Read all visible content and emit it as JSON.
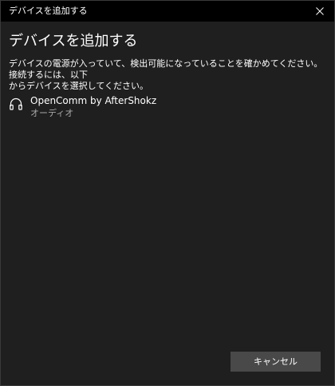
{
  "window": {
    "title": "デバイスを追加する"
  },
  "main": {
    "heading": "デバイスを追加する",
    "instructions_line1": "デバイスの電源が入っていて、検出可能になっていることを確かめてください。接続するには、以下",
    "instructions_line2": "からデバイスを選択してください。"
  },
  "devices": [
    {
      "name": "OpenComm by AfterShokz",
      "type": "オーディオ",
      "icon": "headphones-icon"
    }
  ],
  "footer": {
    "cancel_label": "キャンセル"
  },
  "colors": {
    "background": "#1f1f1f",
    "titlebar": "#000000",
    "text": "#ffffff",
    "secondary_text": "#a8a8a8",
    "button": "#494949"
  }
}
